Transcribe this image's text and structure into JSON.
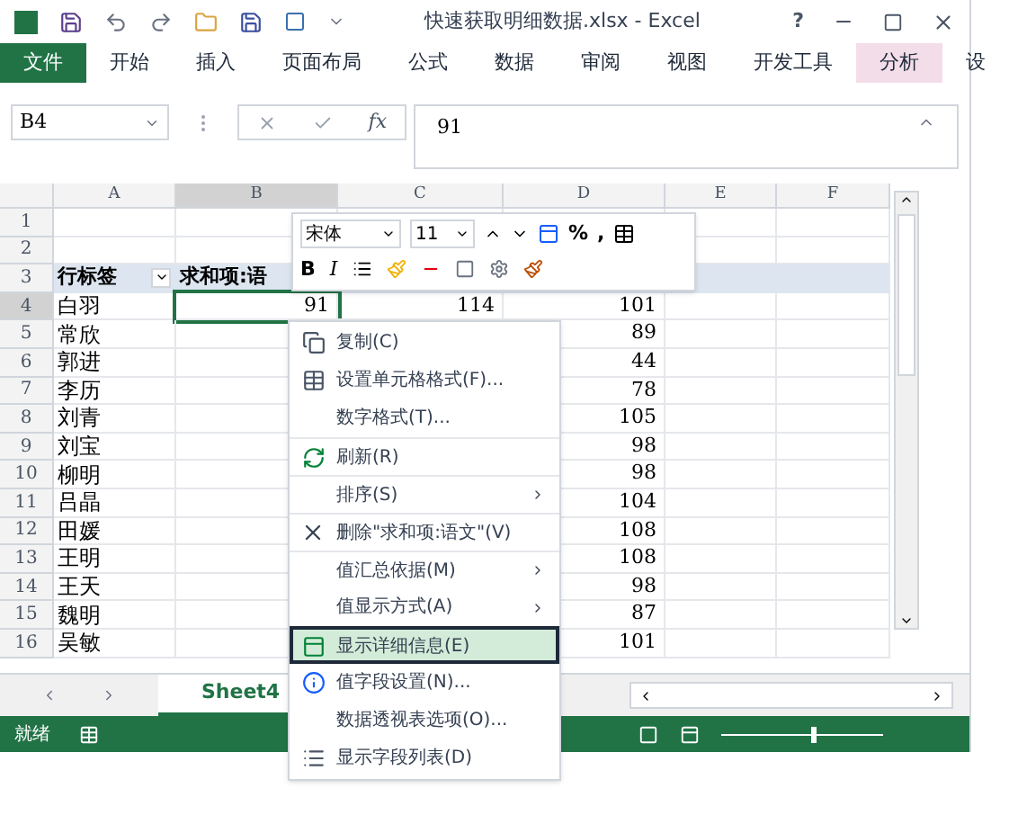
{
  "title_bar": {
    "title": "快速获取明细数据.xlsx - Excel",
    "help": "?"
  },
  "ribbon_tabs": [
    {
      "label": "文件",
      "kind": "file"
    },
    {
      "label": "开始",
      "kind": "normal"
    },
    {
      "label": "插入",
      "kind": "normal"
    },
    {
      "label": "页面布局",
      "kind": "normal"
    },
    {
      "label": "公式",
      "kind": "normal"
    },
    {
      "label": "数据",
      "kind": "normal"
    },
    {
      "label": "审阅",
      "kind": "normal"
    },
    {
      "label": "视图",
      "kind": "normal"
    },
    {
      "label": "开发工具",
      "kind": "normal"
    },
    {
      "label": "分析",
      "kind": "contextual"
    },
    {
      "label": "设",
      "kind": "normal"
    }
  ],
  "formula_bar": {
    "name_box": "B4",
    "fx": "fx",
    "value": "91"
  },
  "sheet": {
    "columns": [
      {
        "label": "A",
        "selected": false
      },
      {
        "label": "B",
        "selected": true
      },
      {
        "label": "C",
        "selected": false
      },
      {
        "label": "D",
        "selected": false
      },
      {
        "label": "E",
        "selected": false
      },
      {
        "label": "F",
        "selected": false
      }
    ],
    "rows": [
      {
        "number": "1",
        "selected": false,
        "cells": [
          "",
          "",
          "",
          ""
        ]
      },
      {
        "number": "2",
        "selected": false,
        "cells": [
          "",
          "",
          "",
          ""
        ]
      },
      {
        "number": "3",
        "selected": false,
        "kind": "header",
        "cells": [
          "行标签",
          "求和项:语",
          "",
          ""
        ]
      },
      {
        "number": "4",
        "selected": true,
        "cells": [
          "白羽",
          "91",
          "114",
          "101"
        ]
      },
      {
        "number": "5",
        "selected": false,
        "cells": [
          "常欣",
          "",
          "",
          "89"
        ]
      },
      {
        "number": "6",
        "selected": false,
        "cells": [
          "郭进",
          "",
          "",
          "44"
        ]
      },
      {
        "number": "7",
        "selected": false,
        "cells": [
          "李历",
          "",
          "",
          "78"
        ]
      },
      {
        "number": "8",
        "selected": false,
        "cells": [
          "刘青",
          "",
          "",
          "105"
        ]
      },
      {
        "number": "9",
        "selected": false,
        "cells": [
          "刘宝",
          "",
          "",
          "98"
        ]
      },
      {
        "number": "10",
        "selected": false,
        "cells": [
          "柳明",
          "",
          "",
          "98"
        ]
      },
      {
        "number": "11",
        "selected": false,
        "cells": [
          "吕晶",
          "",
          "",
          "104"
        ]
      },
      {
        "number": "12",
        "selected": false,
        "cells": [
          "田媛",
          "",
          "",
          "108"
        ]
      },
      {
        "number": "13",
        "selected": false,
        "cells": [
          "王明",
          "",
          "",
          "108"
        ]
      },
      {
        "number": "14",
        "selected": false,
        "cells": [
          "王天",
          "",
          "",
          "98"
        ]
      },
      {
        "number": "15",
        "selected": false,
        "cells": [
          "魏明",
          "",
          "",
          "87"
        ]
      },
      {
        "number": "16",
        "selected": false,
        "cells": [
          "吴敏",
          "",
          "",
          "101"
        ]
      }
    ]
  },
  "mini_toolbar": {
    "font": "宋体",
    "size": "11",
    "bold": "B",
    "italic": "I",
    "percent": "%",
    "comma": ","
  },
  "context_menu": [
    {
      "label": "复制(C)",
      "submenu": false,
      "selected": false,
      "separator_before": false
    },
    {
      "label": "设置单元格格式(F)...",
      "submenu": false,
      "selected": false,
      "separator_before": false
    },
    {
      "label": "数字格式(T)...",
      "submenu": false,
      "selected": false,
      "separator_before": false
    },
    {
      "label": "刷新(R)",
      "submenu": false,
      "selected": false,
      "separator_before": true
    },
    {
      "label": "排序(S)",
      "submenu": true,
      "selected": false,
      "separator_before": true
    },
    {
      "label": "删除\"求和项:语文\"(V)",
      "submenu": false,
      "selected": false,
      "separator_before": true
    },
    {
      "label": "值汇总依据(M)",
      "submenu": true,
      "selected": false,
      "separator_before": true
    },
    {
      "label": "值显示方式(A)",
      "submenu": true,
      "selected": false,
      "separator_before": false
    },
    {
      "label": "显示详细信息(E)",
      "submenu": false,
      "selected": true,
      "separator_before": true
    },
    {
      "label": "值字段设置(N)...",
      "submenu": false,
      "selected": false,
      "separator_before": false
    },
    {
      "label": "数据透视表选项(O)...",
      "submenu": false,
      "selected": false,
      "separator_before": false
    },
    {
      "label": "显示字段列表(D)",
      "submenu": false,
      "selected": false,
      "separator_before": false
    }
  ],
  "sheet_tabs": [
    {
      "label": "Sheet4",
      "selected": true
    }
  ],
  "status_bar": {
    "text": "就绪",
    "zoom_slider": {
      "level": 0.55
    }
  }
}
